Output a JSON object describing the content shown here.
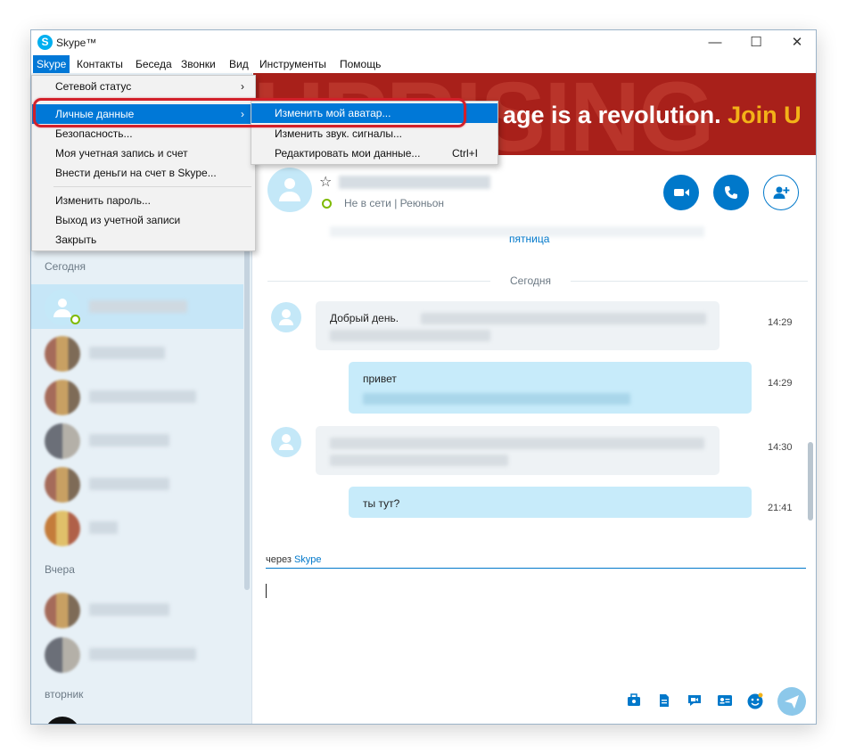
{
  "window": {
    "title": "Skype™",
    "controls": {
      "minimize": "—",
      "maximize": "☐",
      "close": "✕"
    }
  },
  "menubar": {
    "items": [
      "Skype",
      "Контакты",
      "Беседа",
      "Звонки",
      "Вид",
      "Инструменты",
      "Помощь"
    ],
    "active_index": 0
  },
  "skype_menu": {
    "items": [
      {
        "label": "Сетевой статус",
        "submenu": true
      },
      {
        "label": "Личные данные",
        "submenu": true,
        "highlighted": true
      },
      {
        "label": "Безопасность..."
      },
      {
        "label": "Моя учетная запись и счет"
      },
      {
        "label": "Внести деньги на счет в Skype..."
      },
      {
        "label": "Изменить пароль..."
      },
      {
        "label": "Выход из учетной записи"
      },
      {
        "label": "Закрыть"
      }
    ],
    "arrow": "›"
  },
  "personal_submenu": {
    "items": [
      {
        "label": "Изменить мой аватар...",
        "highlighted": true
      },
      {
        "label": "Изменить звук. сигналы..."
      },
      {
        "label": "Редактировать мои данные...",
        "shortcut": "Ctrl+I"
      }
    ]
  },
  "sidebar": {
    "sections": {
      "today": "Сегодня",
      "yesterday": "Вчера",
      "tuesday": "вторник"
    }
  },
  "banner": {
    "text_main": "age is a revolution.",
    "text_join": "Join U",
    "background_word": "UPRISING"
  },
  "conversation": {
    "status": "Не в сети",
    "separator": "|",
    "location": "Реюньон",
    "star": "☆"
  },
  "messages": {
    "friday_label": "пятница",
    "today_separator": "Сегодня",
    "items": [
      {
        "direction": "in",
        "text": "Добрый день.",
        "time": "14:29"
      },
      {
        "direction": "out",
        "text": "привет",
        "time": "14:29"
      },
      {
        "direction": "in",
        "text": "",
        "time": "14:30"
      },
      {
        "direction": "out",
        "text": "ты тут?",
        "time": "21:41"
      }
    ]
  },
  "compose": {
    "via_prefix": "через",
    "via_brand": "Skype"
  },
  "colors": {
    "accent": "#0078d7",
    "skype_blue": "#00aff0",
    "highlight_ring": "#d2202a",
    "banner_red": "#a8201a",
    "join_yellow": "#f3b218"
  }
}
